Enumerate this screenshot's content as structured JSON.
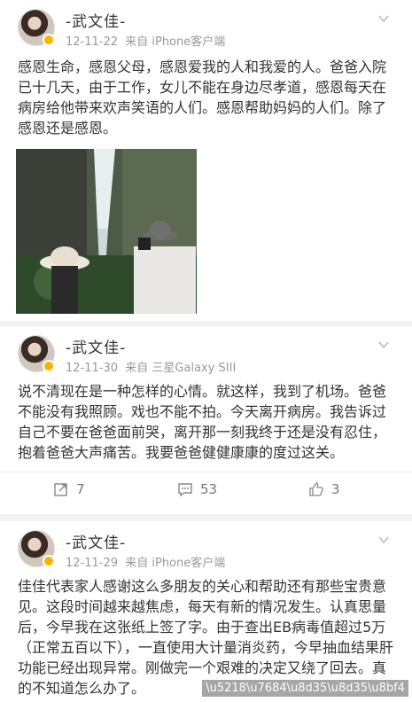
{
  "posts": [
    {
      "user": "-武文佳-",
      "date": "12-11-22",
      "source": "来自 iPhone客户端",
      "text": "感恩生命，感恩父母，感恩爱我的人和我爱的人。爸爸入院已十几天，由于工作，女儿不能在身边尽孝道，感恩每天在病房给他带来欢声笑语的人们。感恩帮助妈妈的人们。除了感恩还是感恩。"
    },
    {
      "user": "-武文佳-",
      "date": "12-11-30",
      "source": "来自 三星Galaxy SIII",
      "text": "说不清现在是一种怎样的心情。就这样，我到了机场。爸爸不能没有我照顾。戏也不能不拍。今天离开病房。我告诉过自己不要在爸爸面前哭，离开那一刻我终于还是没有忍住，抱着爸爸大声痛苦。我要爸爸健健康康的度过这关。",
      "reposts": "7",
      "comments": "53",
      "likes": "3"
    },
    {
      "user": "-武文佳-",
      "date": "12-11-29",
      "source": "来自 iPhone客户端",
      "text": "佳佳代表家人感谢这么多朋友的关心和帮助还有那些宝贵意见。这段时间越来越焦虑，每天有新的情况发生。认真思量后，今早我在这张纸上签了字。由于查出EB病毒值超过5万（正常五百以下），一直使用大计量消炎药，今早抽血结果肝功能已经出现异常。刚做完一个艰难的决定又绕了回去。真的不知道怎么办了。"
    }
  ],
  "watermark": "\\u5218\\u7684\\u8d35\\u8d35\\u8bf4",
  "colors": {
    "meta": "#999999",
    "badge": "#f7b500"
  }
}
